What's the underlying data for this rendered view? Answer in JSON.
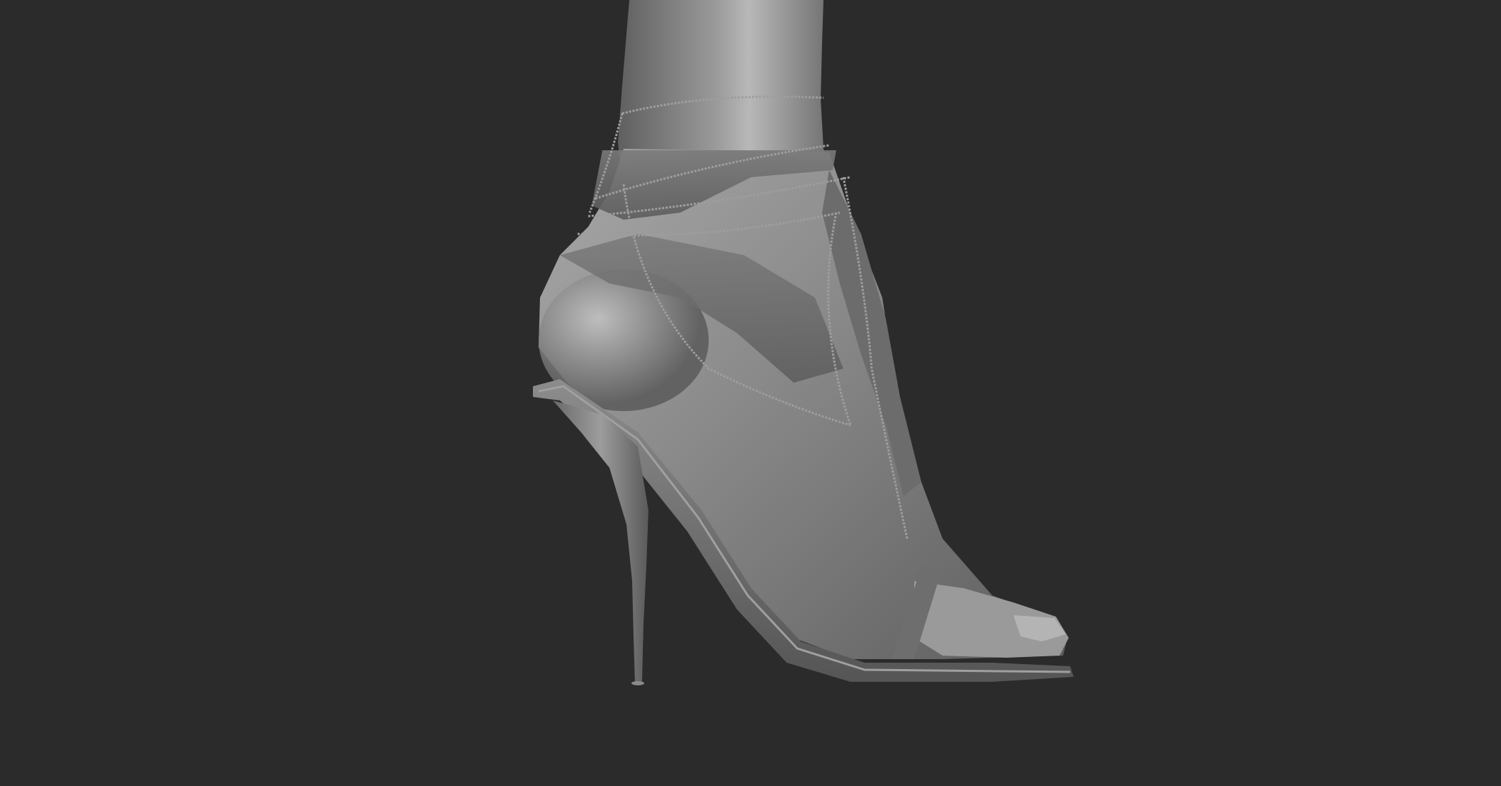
{
  "viewport": {
    "background_color": "#2b2b2b",
    "material_color": "#8a8a8a",
    "subject": "sculpt-render"
  }
}
